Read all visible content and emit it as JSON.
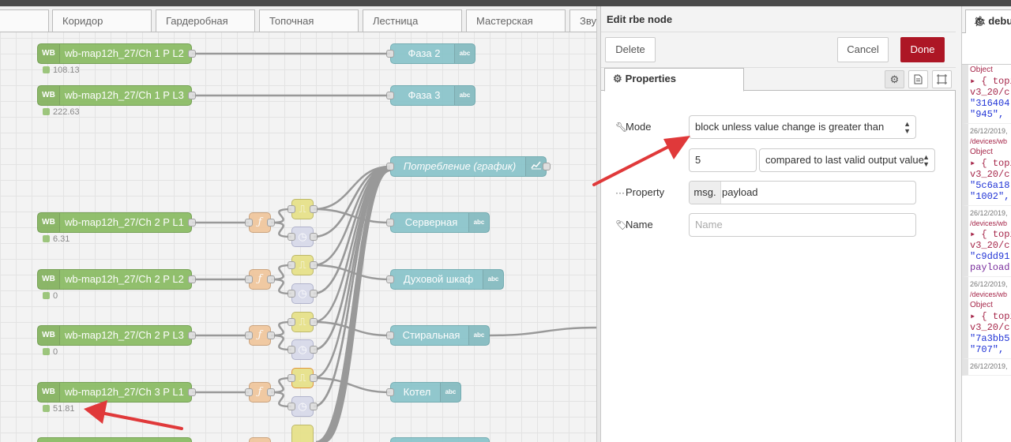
{
  "workspace": {
    "tabs": [
      "Коридор",
      "Гардеробная",
      "Топочная",
      "Лестница",
      "Мастерская",
      "Звук"
    ],
    "inputs": [
      {
        "badge": "WB",
        "label": "wb-map12h_27/Ch 1 P L2",
        "status": "108.13"
      },
      {
        "badge": "WB",
        "label": "wb-map12h_27/Ch 1 P L3",
        "status": "222.63"
      },
      {
        "badge": "WB",
        "label": "wb-map12h_27/Ch 2 P L1",
        "status": "6.31"
      },
      {
        "badge": "WB",
        "label": "wb-map12h_27/Ch 2 P L2",
        "status": "0"
      },
      {
        "badge": "WB",
        "label": "wb-map12h_27/Ch 2 P L3",
        "status": "0"
      },
      {
        "badge": "WB",
        "label": "wb-map12h_27/Ch 3 P L1",
        "status": "51.81"
      }
    ],
    "outputs": [
      {
        "label": "Фаза 2",
        "badge": "abc"
      },
      {
        "label": "Фаза 3",
        "badge": "abc"
      },
      {
        "label": "Потребление (график)",
        "badge": "chart"
      },
      {
        "label": "Серверная",
        "badge": "abc"
      },
      {
        "label": "Духовой шкаф",
        "badge": "abc"
      },
      {
        "label": "Стиральная",
        "badge": "abc"
      },
      {
        "label": "Котел",
        "badge": "abc"
      }
    ]
  },
  "tray": {
    "title": "Edit rbe node",
    "delete_label": "Delete",
    "cancel_label": "Cancel",
    "done_label": "Done",
    "tab_label": "Properties",
    "mode_label": "Mode",
    "mode_value": "block unless value change is greater than",
    "gap_value": "5",
    "compare_value": "compared to last valid output value",
    "property_label": "Property",
    "property_prefix": "msg.",
    "property_value": "payload",
    "name_label": "Name",
    "name_placeholder": "Name"
  },
  "debug": {
    "tab_label": "debug",
    "messages": [
      {
        "meta": "",
        "topic": "",
        "type": "Object",
        "lines": [
          "▸ { topi",
          "v3_20/c",
          "\"316404",
          "\"945\","
        ]
      },
      {
        "meta": "26/12/2019,",
        "topic": "/devices/wb",
        "type": "Object",
        "lines": [
          "▸ { topi",
          "v3_20/c",
          "\"5c6a18",
          "\"1002\","
        ]
      },
      {
        "meta": "26/12/2019,",
        "topic": "/devices/wb",
        "type": "",
        "lines": [
          "▸ { topi",
          "v3_20/c",
          "\"c9dd91",
          "payload"
        ]
      },
      {
        "meta": "26/12/2019,",
        "topic": "/devices/wb",
        "type": "Object",
        "lines": [
          "▸ { topi",
          "v3_20/c",
          "\"7a3bb5",
          "\"707\","
        ]
      },
      {
        "meta": "26/12/2019,",
        "topic": "",
        "type": "",
        "lines": []
      }
    ]
  },
  "colors": {
    "input_node": "#87ba5f",
    "output_node": "#87c3c9",
    "function_node": "#f0c59a",
    "rbe_node": "#e6e185",
    "delay_node": "#d7d9ea",
    "done_button": "#ad1625",
    "annotation_arrow": "#e0393a"
  }
}
